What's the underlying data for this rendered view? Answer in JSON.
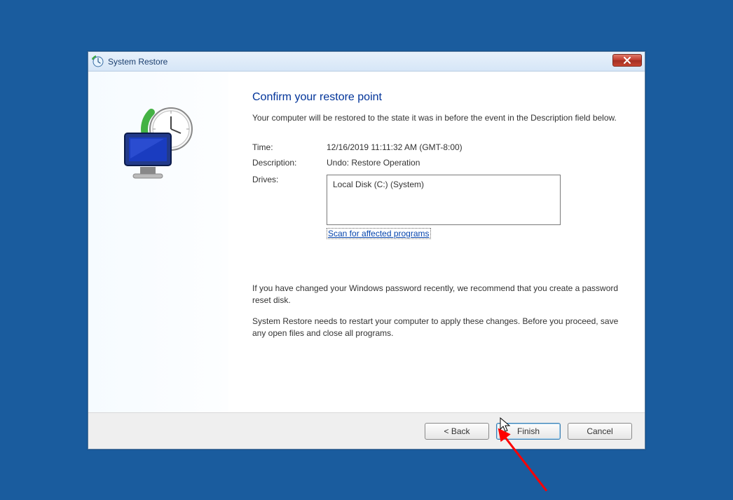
{
  "titlebar": {
    "title": "System Restore"
  },
  "heading": "Confirm your restore point",
  "intro": "Your computer will be restored to the state it was in before the event in the Description field below.",
  "fields": {
    "time_label": "Time:",
    "time_value": "12/16/2019 11:11:32 AM (GMT-8:00)",
    "description_label": "Description:",
    "description_value": "Undo: Restore Operation",
    "drives_label": "Drives:",
    "drives_value": "Local Disk (C:) (System)"
  },
  "link": "Scan for affected programs",
  "notes": {
    "p1": "If you have changed your Windows password recently, we recommend that you create a password reset disk.",
    "p2": "System Restore needs to restart your computer to apply these changes. Before you proceed, save any open files and close all programs."
  },
  "buttons": {
    "back": "< Back",
    "finish": "Finish",
    "cancel": "Cancel"
  }
}
